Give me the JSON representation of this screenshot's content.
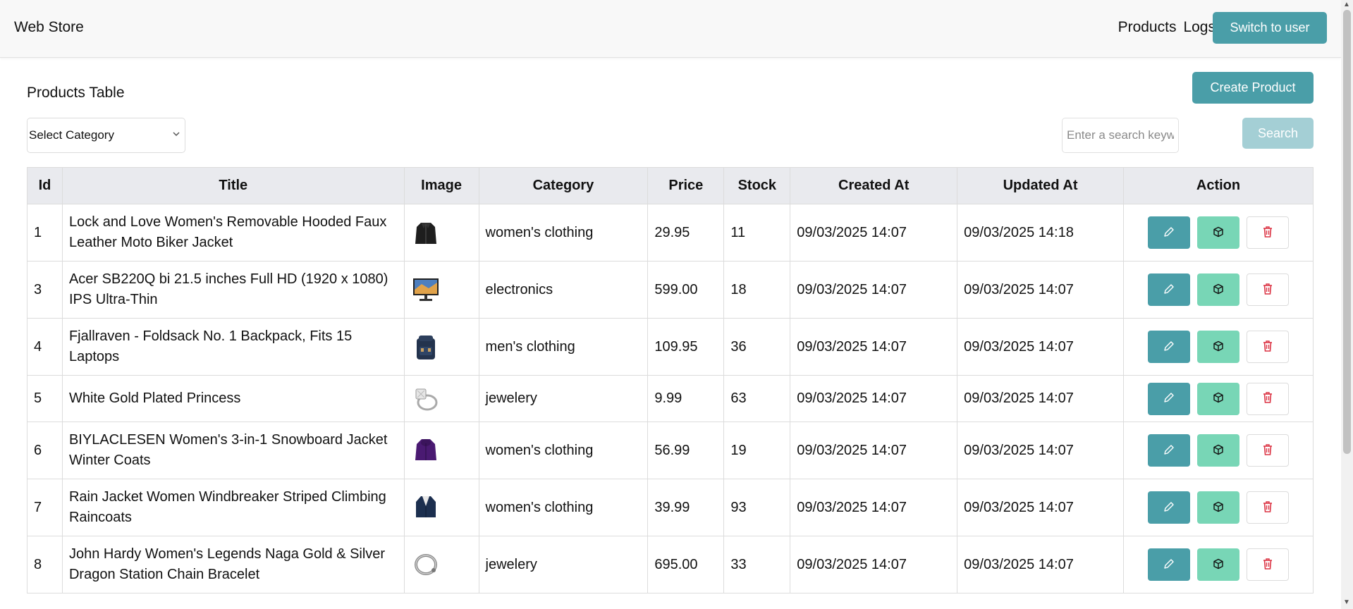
{
  "header": {
    "brand": "Web Store",
    "nav": [
      "Products",
      "Logs"
    ],
    "switch_label": "Switch to user"
  },
  "main": {
    "title": "Products Table",
    "create_label": "Create Product",
    "category_select": {
      "value": "Select Category"
    },
    "search": {
      "placeholder": "Enter a search keyword",
      "button_label": "Search"
    }
  },
  "table": {
    "columns": [
      "Id",
      "Title",
      "Image",
      "Category",
      "Price",
      "Stock",
      "Created At",
      "Updated At",
      "Action"
    ],
    "rows": [
      {
        "id": "1",
        "title": "Lock and Love Women's Removable Hooded Faux Leather Moto Biker Jacket",
        "image": "black-leather-jacket",
        "category": "women's clothing",
        "price": "29.95",
        "stock": "11",
        "created": "09/03/2025 14:07",
        "updated": "09/03/2025 14:18"
      },
      {
        "id": "3",
        "title": "Acer SB220Q bi 21.5 inches Full HD (1920 x 1080) IPS Ultra-Thin",
        "image": "monitor",
        "category": "electronics",
        "price": "599.00",
        "stock": "18",
        "created": "09/03/2025 14:07",
        "updated": "09/03/2025 14:07"
      },
      {
        "id": "4",
        "title": "Fjallraven - Foldsack No. 1 Backpack, Fits 15 Laptops",
        "image": "backpack",
        "category": "men's clothing",
        "price": "109.95",
        "stock": "36",
        "created": "09/03/2025 14:07",
        "updated": "09/03/2025 14:07"
      },
      {
        "id": "5",
        "title": "White Gold Plated Princess",
        "image": "diamond-ring",
        "category": "jewelery",
        "price": "9.99",
        "stock": "63",
        "created": "09/03/2025 14:07",
        "updated": "09/03/2025 14:07"
      },
      {
        "id": "6",
        "title": "BIYLACLESEN Women's 3-in-1 Snowboard Jacket Winter Coats",
        "image": "purple-jacket",
        "category": "women's clothing",
        "price": "56.99",
        "stock": "19",
        "created": "09/03/2025 14:07",
        "updated": "09/03/2025 14:07"
      },
      {
        "id": "7",
        "title": "Rain Jacket Women Windbreaker Striped Climbing Raincoats",
        "image": "navy-jacket",
        "category": "women's clothing",
        "price": "39.99",
        "stock": "93",
        "created": "09/03/2025 14:07",
        "updated": "09/03/2025 14:07"
      },
      {
        "id": "8",
        "title": "John Hardy Women's Legends Naga Gold & Silver Dragon Station Chain Bracelet",
        "image": "bracelet",
        "category": "jewelery",
        "price": "695.00",
        "stock": "33",
        "created": "09/03/2025 14:07",
        "updated": "09/03/2025 14:07"
      }
    ]
  },
  "colors": {
    "primary": "#4a9ea8",
    "secondary": "#78d6b6",
    "danger": "#dc3545",
    "disabled": "#a4cfd5"
  }
}
